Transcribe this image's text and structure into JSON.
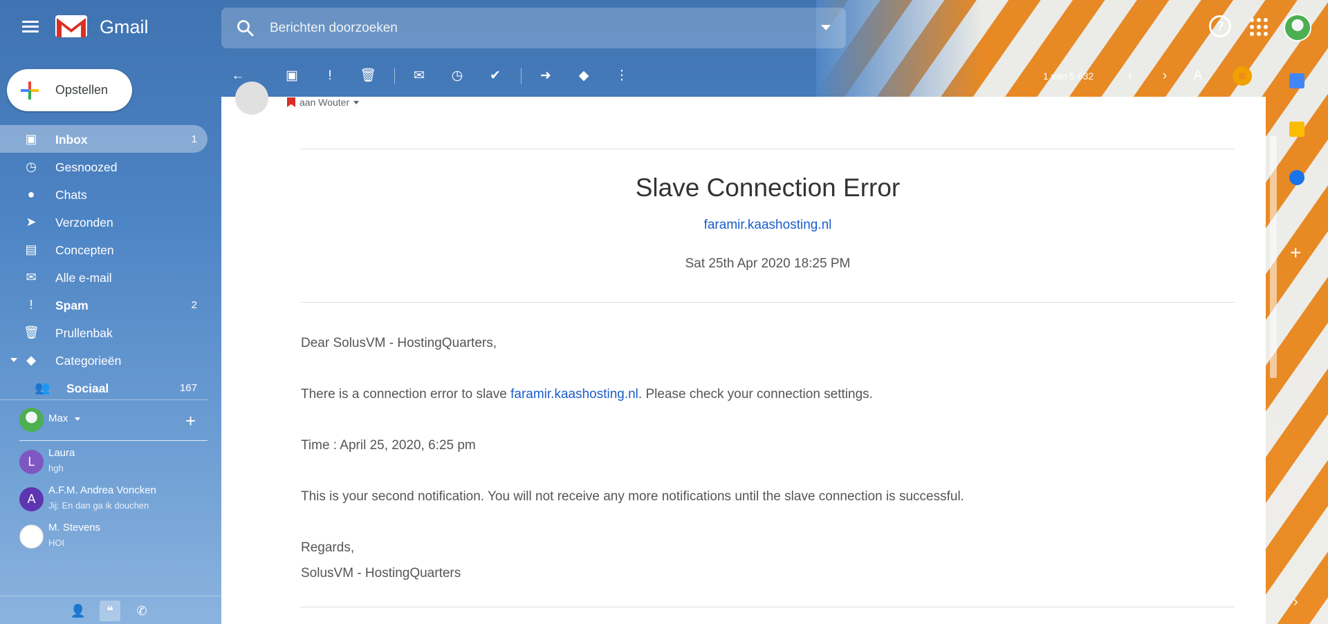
{
  "header": {
    "app_name": "Gmail",
    "search_placeholder": "Berichten doorzoeken"
  },
  "compose": {
    "label": "Opstellen"
  },
  "sidebar": {
    "items": [
      {
        "label": "Inbox",
        "count": "1",
        "icon": "inbox-icon"
      },
      {
        "label": "Gesnoozed",
        "count": "",
        "icon": "clock-icon"
      },
      {
        "label": "Chats",
        "count": "",
        "icon": "chat-icon"
      },
      {
        "label": "Verzonden",
        "count": "",
        "icon": "send-icon"
      },
      {
        "label": "Concepten",
        "count": "",
        "icon": "draft-icon"
      },
      {
        "label": "Alle e-mail",
        "count": "",
        "icon": "mail-icon"
      },
      {
        "label": "Spam",
        "count": "2",
        "icon": "spam-icon"
      },
      {
        "label": "Prullenbak",
        "count": "",
        "icon": "trash-icon"
      },
      {
        "label": "Categorieën",
        "count": "",
        "icon": "label-icon"
      },
      {
        "label": "Sociaal",
        "count": "167",
        "icon": "people-icon"
      }
    ]
  },
  "hangouts": {
    "me": "Max",
    "contacts": [
      {
        "initial": "L",
        "name": "Laura",
        "message": "hgh",
        "color": "#7e57c2"
      },
      {
        "initial": "A",
        "name": "A.F.M. Andrea Voncken",
        "message": "Jij: En dan ga ik douchen",
        "color": "#5e35b1"
      },
      {
        "initial": "",
        "name": "M. Stevens",
        "message": "HOI",
        "color": "#ffffff"
      }
    ]
  },
  "toolbar": {
    "pager": "1 van 5.632"
  },
  "email": {
    "to": "aan Wouter",
    "title": "Slave Connection Error",
    "host_link": "faramir.kaashosting.nl",
    "date": "Sat 25th Apr 2020 18:25 PM",
    "greeting": "Dear SolusVM - HostingQuarters,",
    "error_pre": "There is a connection error to slave ",
    "error_link": "faramir.kaashosting.nl",
    "error_post": ". Please check your connection settings.",
    "time_line": "Time : April 25, 2020, 6:25 pm",
    "notice": "This is your second notification. You will not receive any more notifications until the slave connection is successful.",
    "regards": "Regards,",
    "signature": "SolusVM - HostingQuarters"
  },
  "colors": {
    "link": "#1a5dc9",
    "sidebar_bg": "#4d84c4",
    "gmail_red": "#d93025"
  }
}
